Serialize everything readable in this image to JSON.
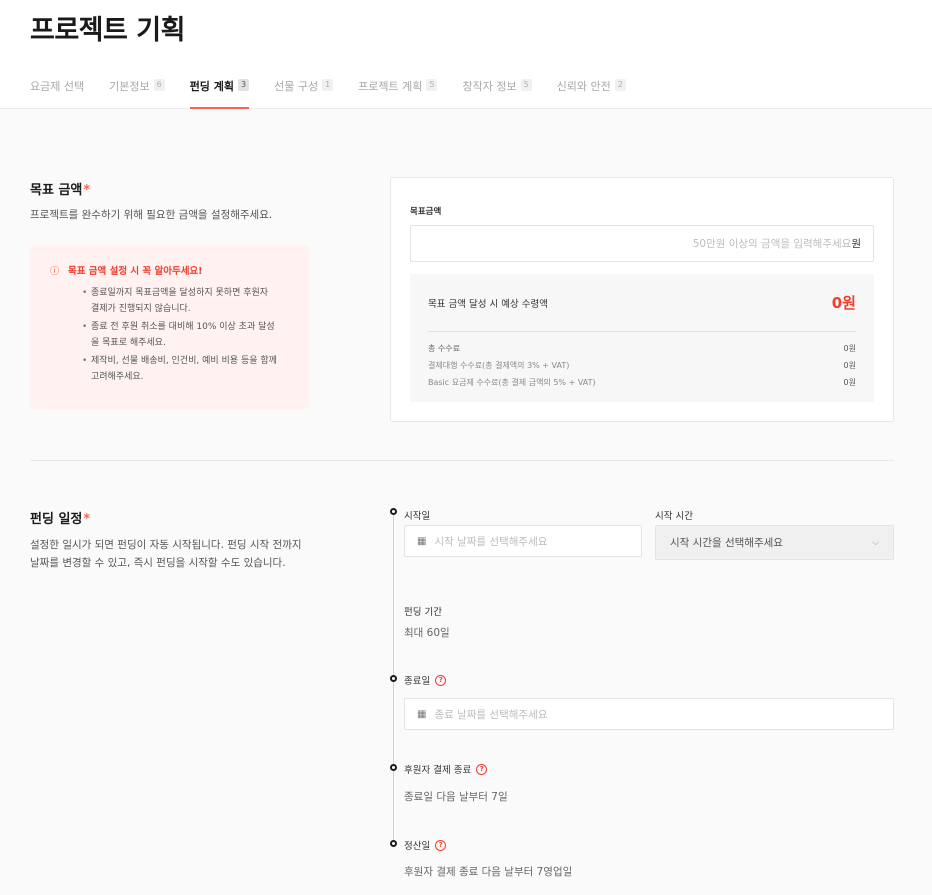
{
  "page": {
    "title": "프로젝트 기획"
  },
  "tabs": [
    {
      "label": "요금제 선택",
      "count": ""
    },
    {
      "label": "기본정보",
      "count": "6"
    },
    {
      "label": "펀딩 계획",
      "count": "3"
    },
    {
      "label": "선물 구성",
      "count": "1"
    },
    {
      "label": "프로젝트 계획",
      "count": "5"
    },
    {
      "label": "창작자 정보",
      "count": "5"
    },
    {
      "label": "신뢰와 안전",
      "count": "2"
    }
  ],
  "goal": {
    "title": "목표 금액",
    "required_mark": "*",
    "desc": "프로젝트를 완수하기 위해 필요한 금액을 설정해주세요.",
    "notice": {
      "icon": "!",
      "title": "목표 금액 설정 시 꼭 알아두세요!",
      "items": [
        "종료일까지 목표금액을 달성하지 못하면 후원자 결제가 진행되지 않습니다.",
        "종료 전 후원 취소를 대비해 10% 이상 초과 달성을 목표로 해주세요.",
        "제작비, 선물 배송비, 인건비, 예비 비용 등을 함께 고려해주세요."
      ]
    },
    "field_label": "목표금액",
    "placeholder": "50만원 이상의 금액을 입력해주세요",
    "unit": "원",
    "summary": {
      "expected_label": "목표 금액 달성 시 예상 수령액",
      "expected_value": "0원",
      "fees": [
        {
          "label": "총 수수료",
          "value": "0원"
        },
        {
          "label": "결제대행 수수료(총 결제액의 3% + VAT)",
          "value": "0원"
        },
        {
          "label": "Basic 요금제 수수료(총 결제 금액의 5% + VAT)",
          "value": "0원"
        }
      ]
    }
  },
  "schedule": {
    "title": "펀딩 일정",
    "required_mark": "*",
    "desc_lines": [
      "설정한 일시가 되면 펀딩이 자동 시작됩니다. 펀딩 시작 전까지",
      "날짜를 변경할 수 있고, 즉시 펀딩을 시작할 수도 있습니다."
    ],
    "start_date": {
      "label": "시작일",
      "placeholder": "시작 날짜를 선택해주세요"
    },
    "start_time": {
      "label": "시작 시간",
      "placeholder": "시작 시간을 선택해주세요"
    },
    "period": {
      "label": "펀딩 기간",
      "value": "최대 60일"
    },
    "end_date": {
      "label": "종료일",
      "placeholder": "종료 날짜를 선택해주세요"
    },
    "payment_end": {
      "label": "후원자 결제 종료",
      "value": "종료일 다음 날부터 7일"
    },
    "settlement": {
      "label": "정산일",
      "value": "후원자 결제 종료 다음 날부터 7영업일"
    }
  },
  "icons": {
    "calendar": "calendar-icon",
    "help": "question-icon",
    "chevron": "chevron-down-icon",
    "alert": "alert-icon"
  },
  "colors": {
    "accent": "#f86453",
    "alert_red": "#f23e2c",
    "notice_bg": "#fff2f1"
  }
}
